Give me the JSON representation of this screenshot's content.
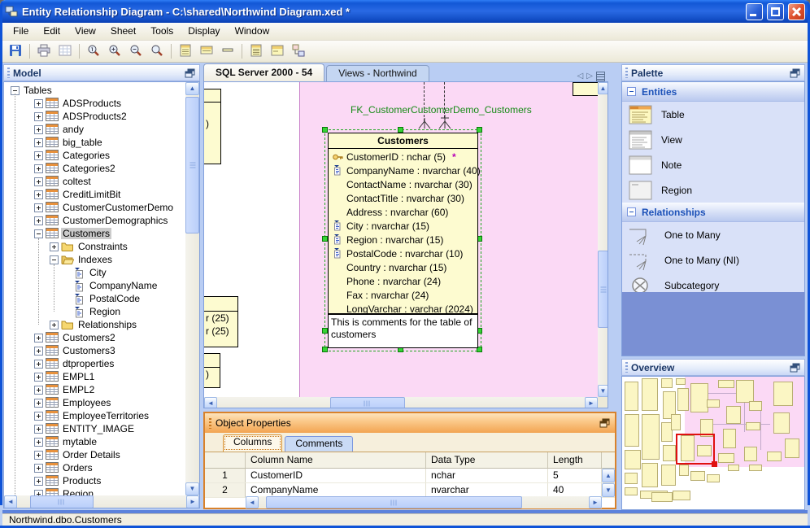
{
  "window": {
    "title": "Entity Relationship Diagram - C:\\shared\\Northwind Diagram.xed *",
    "controls": [
      "minimize",
      "maximize",
      "close"
    ]
  },
  "menu_bar": {
    "items": [
      "File",
      "Edit",
      "View",
      "Sheet",
      "Tools",
      "Display",
      "Window"
    ]
  },
  "toolbar": {
    "groups": [
      [
        "save"
      ],
      [
        "print",
        "grid"
      ],
      [
        "zoom-100",
        "zoom-in",
        "zoom-out",
        "zoom"
      ],
      [
        "table-columns",
        "table-compact",
        "table-line"
      ],
      [
        "table-full",
        "table-window",
        "relationship"
      ]
    ]
  },
  "model_panel": {
    "title": "Model",
    "tree": [
      {
        "label": "Tables",
        "depth": 0,
        "exp": "minus",
        "icon": null
      },
      {
        "label": "ADSProducts",
        "depth": 1,
        "exp": "plus",
        "icon": "table"
      },
      {
        "label": "ADSProducts2",
        "depth": 1,
        "exp": "plus",
        "icon": "table"
      },
      {
        "label": "andy",
        "depth": 1,
        "exp": "plus",
        "icon": "table"
      },
      {
        "label": "big_table",
        "depth": 1,
        "exp": "plus",
        "icon": "table"
      },
      {
        "label": "Categories",
        "depth": 1,
        "exp": "plus",
        "icon": "table"
      },
      {
        "label": "Categories2",
        "depth": 1,
        "exp": "plus",
        "icon": "table"
      },
      {
        "label": "coltest",
        "depth": 1,
        "exp": "plus",
        "icon": "table"
      },
      {
        "label": "CreditLimitBit",
        "depth": 1,
        "exp": "plus",
        "icon": "table"
      },
      {
        "label": "CustomerCustomerDemo",
        "depth": 1,
        "exp": "plus",
        "icon": "table"
      },
      {
        "label": "CustomerDemographics",
        "depth": 1,
        "exp": "plus",
        "icon": "table"
      },
      {
        "label": "Customers",
        "depth": 1,
        "exp": "minus",
        "icon": "table",
        "selected": true
      },
      {
        "label": "Constraints",
        "depth": 2,
        "exp": "plus",
        "icon": "folder"
      },
      {
        "label": "Indexes",
        "depth": 2,
        "exp": "minus",
        "icon": "folder-open"
      },
      {
        "label": "City",
        "depth": 3,
        "exp": null,
        "icon": "index"
      },
      {
        "label": "CompanyName",
        "depth": 3,
        "exp": null,
        "icon": "index"
      },
      {
        "label": "PostalCode",
        "depth": 3,
        "exp": null,
        "icon": "index"
      },
      {
        "label": "Region",
        "depth": 3,
        "exp": null,
        "icon": "index"
      },
      {
        "label": "Relationships",
        "depth": 2,
        "exp": "plus",
        "icon": "folder"
      },
      {
        "label": "Customers2",
        "depth": 1,
        "exp": "plus",
        "icon": "table"
      },
      {
        "label": "Customers3",
        "depth": 1,
        "exp": "plus",
        "icon": "table"
      },
      {
        "label": "dtproperties",
        "depth": 1,
        "exp": "plus",
        "icon": "table"
      },
      {
        "label": "EMPL1",
        "depth": 1,
        "exp": "plus",
        "icon": "table"
      },
      {
        "label": "EMPL2",
        "depth": 1,
        "exp": "plus",
        "icon": "table"
      },
      {
        "label": "Employees",
        "depth": 1,
        "exp": "plus",
        "icon": "table"
      },
      {
        "label": "EmployeeTerritories",
        "depth": 1,
        "exp": "plus",
        "icon": "table"
      },
      {
        "label": "ENTITY_IMAGE",
        "depth": 1,
        "exp": "plus",
        "icon": "table"
      },
      {
        "label": "mytable",
        "depth": 1,
        "exp": "plus",
        "icon": "table"
      },
      {
        "label": "Order Details",
        "depth": 1,
        "exp": "plus",
        "icon": "table"
      },
      {
        "label": "Orders",
        "depth": 1,
        "exp": "plus",
        "icon": "table"
      },
      {
        "label": "Products",
        "depth": 1,
        "exp": "plus",
        "icon": "table"
      },
      {
        "label": "Region",
        "depth": 1,
        "exp": "plus",
        "icon": "table"
      }
    ]
  },
  "diagram": {
    "tabs": [
      {
        "label": "SQL Server 2000 - 54",
        "active": true
      },
      {
        "label": "Views - Northwind",
        "active": false
      }
    ],
    "fk_label": "FK_CustomerCustomerDemo_Customers",
    "entity": {
      "title": "Customers",
      "pk_marker": "*",
      "columns": [
        {
          "icon": "key",
          "text": "CustomerID : nchar (5)",
          "pk": true
        },
        {
          "icon": "index",
          "text": "CompanyName : nvarchar (40)"
        },
        {
          "icon": null,
          "text": "ContactName : nvarchar (30)"
        },
        {
          "icon": null,
          "text": "ContactTitle : nvarchar (30)"
        },
        {
          "icon": null,
          "text": "Address : nvarchar (60)"
        },
        {
          "icon": "index",
          "text": "City : nvarchar (15)"
        },
        {
          "icon": "index",
          "text": "Region : nvarchar (15)"
        },
        {
          "icon": "index",
          "text": "PostalCode : nvarchar (10)"
        },
        {
          "icon": null,
          "text": "Country : nvarchar (15)"
        },
        {
          "icon": null,
          "text": "Phone : nvarchar (24)"
        },
        {
          "icon": null,
          "text": "Fax : nvarchar (24)"
        },
        {
          "icon": null,
          "text": "LongVarchar : varchar (2024)"
        }
      ],
      "comment": "This is comments for the table of customers"
    },
    "partial_entities": [
      {
        "rows": [
          ")"
        ]
      },
      {
        "rows": [
          "r (25)",
          "r (25)"
        ]
      },
      {
        "rows": [
          ")"
        ]
      },
      {
        "rows": []
      }
    ]
  },
  "object_properties": {
    "title": "Object Properties",
    "tabs": [
      {
        "label": "Columns",
        "active": true
      },
      {
        "label": "Comments",
        "active": false
      }
    ],
    "grid": {
      "headers": [
        "Column Name",
        "Data Type",
        "Length"
      ],
      "rows": [
        {
          "num": "1",
          "cells": [
            "CustomerID",
            "nchar",
            "5"
          ]
        },
        {
          "num": "2",
          "cells": [
            "CompanyName",
            "nvarchar",
            "40"
          ]
        }
      ]
    }
  },
  "palette": {
    "title": "Palette",
    "sections": [
      {
        "label": "Entities",
        "items": [
          {
            "label": "Table",
            "icon": "thumb-table"
          },
          {
            "label": "View",
            "icon": "thumb-view"
          },
          {
            "label": "Note",
            "icon": "thumb-note"
          },
          {
            "label": "Region",
            "icon": "thumb-region"
          }
        ]
      },
      {
        "label": "Relationships",
        "items": [
          {
            "label": "One to Many",
            "icon": "one-many"
          },
          {
            "label": "One to Many (NI)",
            "icon": "one-many-ni"
          },
          {
            "label": "Subcategory",
            "icon": "subcategory"
          }
        ]
      }
    ]
  },
  "overview": {
    "title": "Overview"
  },
  "status_bar": {
    "text": "Northwind.dbo.Customers"
  },
  "colors": {
    "titlebar_blue": "#1257d6",
    "canvas_pink": "#fbd9f5",
    "entity_yellow": "#fdfbd0",
    "selection_green": "#35d435",
    "fk_label_green": "#158a15",
    "props_orange": "#f2a452",
    "palette_blue": "#d9e1f8",
    "viewport_red": "#e01010"
  }
}
